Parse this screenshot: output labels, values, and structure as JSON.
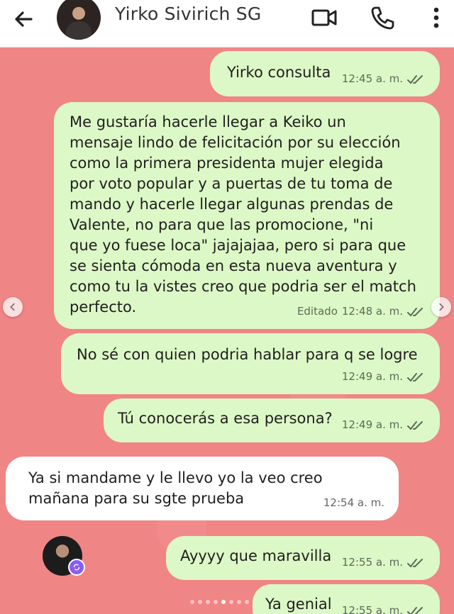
{
  "header": {
    "contact_name": "Yirko Sivirich SG"
  },
  "messages": [
    {
      "text": "Yirko consulta",
      "time": "12:45 a. m.",
      "edited": ""
    },
    {
      "text": "Me gustaría hacerle llegar a Keiko un\nmensaje lindo de felicitación por su elección\ncomo la primera presidenta mujer elegida\npor voto popular y a puertas de tu toma de\nmando y hacerle llegar algunas prendas de\nValente, no para que las promocione, \"ni\nque yo fuese loca\" jajajajaa, pero si para que\nse sienta cómoda en esta nueva aventura y\ncomo tu la vistes creo que podria ser el match\nperfecto.",
      "time": "12:48 a. m.",
      "edited": "Editado"
    },
    {
      "text": "No sé con quien podria hablar para q se logre",
      "time": "12:49 a. m.",
      "edited": ""
    },
    {
      "text": "Tú conocerás a esa persona?",
      "time": "12:49 a. m.",
      "edited": ""
    },
    {
      "text": "Ya si mandame y le llevo yo la veo creo\nmañana para su sgte prueba",
      "time": "12:54 a. m.",
      "edited": ""
    },
    {
      "text": "Ayyyy que maravilla",
      "time": "12:55 a. m.",
      "edited": ""
    },
    {
      "text": "Ya genial",
      "time": "12:55 a. m.",
      "edited": ""
    }
  ],
  "colors": {
    "chat_background": "#f08585",
    "outgoing_bubble": "#dcf8c6",
    "incoming_bubble": "#ffffff",
    "badge": "#8a5cf6"
  },
  "icons": [
    "back-arrow-icon",
    "video-call-icon",
    "phone-icon",
    "more-options-icon",
    "double-check-icon",
    "chevron-left-icon",
    "chevron-right-icon",
    "sync-badge-icon"
  ]
}
